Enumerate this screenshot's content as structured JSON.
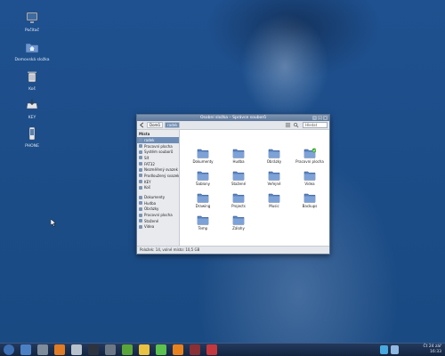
{
  "desktop": {
    "icons": [
      {
        "name": "computer-icon",
        "label": "Počítač"
      },
      {
        "name": "home-folder-icon",
        "label": "Domovská složka"
      },
      {
        "name": "trash-icon",
        "label": "Koš"
      },
      {
        "name": "usb-drive-icon",
        "label": "KEY"
      },
      {
        "name": "phone-icon",
        "label": "PHONE"
      }
    ]
  },
  "window": {
    "title": "Osobní složka – Správce souborů",
    "toolbar": {
      "home_label": "Domů",
      "path_label": "radek",
      "search_placeholder": "Hledat"
    },
    "sidebar": {
      "places_header": "Místa",
      "places": [
        {
          "label": "radek",
          "selected": true
        },
        {
          "label": "Pracovní plocha"
        },
        {
          "label": "Systém souborů"
        },
        {
          "label": "Síť"
        },
        {
          "label": "FAT32"
        },
        {
          "label": "Nezměřený svazek"
        },
        {
          "label": "Prodloužený svazek"
        },
        {
          "label": "KEY"
        },
        {
          "label": "Koš"
        }
      ],
      "bookmarks": [
        {
          "label": "Dokumenty"
        },
        {
          "label": "Hudba"
        },
        {
          "label": "Obrázky"
        },
        {
          "label": "Pracovní plocha"
        },
        {
          "label": "Stažené"
        },
        {
          "label": "Videa"
        }
      ]
    },
    "folders": [
      {
        "label": "Dokumenty",
        "badge": false
      },
      {
        "label": "Hudba",
        "badge": false
      },
      {
        "label": "Obrázky",
        "badge": false
      },
      {
        "label": "Pracovní plocha",
        "badge": true
      },
      {
        "label": "Šablony",
        "badge": false
      },
      {
        "label": "Stažené",
        "badge": false
      },
      {
        "label": "Veřejné",
        "badge": false
      },
      {
        "label": "Videa",
        "badge": false
      },
      {
        "label": "Drawing",
        "badge": false
      },
      {
        "label": "Projects",
        "badge": false
      },
      {
        "label": "Music",
        "badge": false
      },
      {
        "label": "Backups",
        "badge": false
      },
      {
        "label": "Temp",
        "badge": false
      },
      {
        "label": "Zálohy",
        "badge": false
      }
    ],
    "status": "Položek: 14, volné místo: 10,5 GB"
  },
  "taskbar": {
    "apps": [
      {
        "name": "fedora-menu-icon",
        "color": "#3c6eb4"
      },
      {
        "name": "browser-icon",
        "color": "#4c80c4"
      },
      {
        "name": "system-monitor-icon",
        "color": "#7f8c9b"
      },
      {
        "name": "firefox-icon",
        "color": "#e07c26"
      },
      {
        "name": "shortcut-icon",
        "color": "#b8c2cd"
      },
      {
        "name": "terminal-icon",
        "color": "#2d3440"
      },
      {
        "name": "image-viewer-icon",
        "color": "#6d7886"
      },
      {
        "name": "messenger-icon",
        "color": "#5aa53a"
      },
      {
        "name": "banshee-icon",
        "color": "#e9c241"
      },
      {
        "name": "media-player-icon",
        "color": "#5cc14e"
      },
      {
        "name": "vlc-icon",
        "color": "#e8821e"
      },
      {
        "name": "audio-editor-icon",
        "color": "#8a2f34"
      },
      {
        "name": "text-editor-icon",
        "color": "#c3383e"
      }
    ],
    "time": "16:33",
    "date": "Čt 24 zář"
  },
  "colors": {
    "desktop": "#1d4f86",
    "selection": "#6d8db7",
    "folder": "#5b83c4"
  }
}
